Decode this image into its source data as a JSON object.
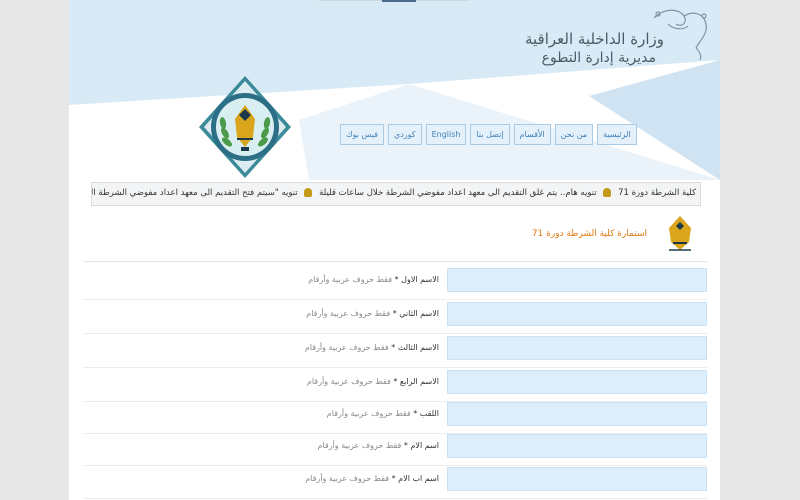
{
  "header": {
    "ministry_title": "وزارة الداخلية العراقية",
    "directorate_title": "مديرية إدارة التطوع",
    "logo_icon": "ministry-emblem-icon",
    "colors": {
      "header_bg": "#dcecf7",
      "accent": "#e07a14",
      "nav_text": "#3e7fb7"
    }
  },
  "nav": {
    "items": [
      {
        "label": "الرئيسية"
      },
      {
        "label": "من نحن"
      },
      {
        "label": "الأقسام"
      },
      {
        "label": "إتصل بنا"
      },
      {
        "label": "English"
      },
      {
        "label": "كوردي"
      },
      {
        "label": "فيس بوك"
      }
    ]
  },
  "ticker": {
    "item1": "كلية الشرطة دورة 71",
    "item2": "تنويه هام.. يتم غلق التقديم الى معهد اعداد مفوضي الشرطة خلال ساعات قليلة",
    "item3": "تنويه \"سيتم فتح التقديم الى معهد اعداد مفوضي الشرطة الدو"
  },
  "form": {
    "title": "استمارة كلية الشرطة دورة 71",
    "fields": [
      {
        "label": "الاسم الاول",
        "required": "*",
        "hint": "فقط حروف عربية وأرقام",
        "value": ""
      },
      {
        "label": "الاسم الثاني",
        "required": "*",
        "hint": "فقط حروف عربية وأرقام",
        "value": ""
      },
      {
        "label": "الاسم الثالث",
        "required": "*",
        "hint": "فقط حروف عربية وأرقام",
        "value": ""
      },
      {
        "label": "الاسم الرابع",
        "required": "*",
        "hint": "فقط حروف عربية وأرقام",
        "value": ""
      },
      {
        "label": "اللقب",
        "required": "*",
        "hint": "فقط حروف عربية وأرقام",
        "value": ""
      },
      {
        "label": "اسم الام",
        "required": "*",
        "hint": "فقط حروف عربية وأرقام",
        "value": ""
      },
      {
        "label": "اسم اب الام",
        "required": "*",
        "hint": "فقط حروف عربية وأرقام",
        "value": ""
      }
    ]
  }
}
